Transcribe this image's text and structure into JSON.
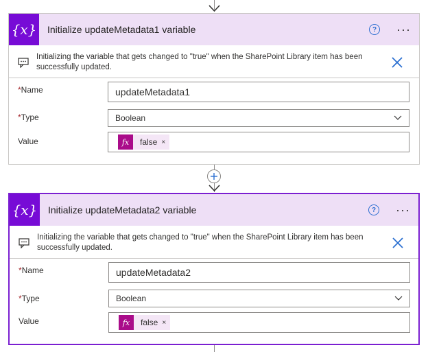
{
  "cards": [
    {
      "title": "Initialize updateMetadata1 variable",
      "icon_text": "{x}",
      "help_label": "?",
      "more_label": "···",
      "info": "Initializing the variable that gets changed to \"true\" when the SharePoint Library item has been successfully updated.",
      "name_label": "Name",
      "name_value": "updateMetadata1",
      "type_label": "Type",
      "type_value": "Boolean",
      "value_label": "Value",
      "token": {
        "fx": "fx",
        "text": "false",
        "remove": "×"
      }
    },
    {
      "title": "Initialize updateMetadata2 variable",
      "icon_text": "{x}",
      "help_label": "?",
      "more_label": "···",
      "info": "Initializing the variable that gets changed to \"true\" when the SharePoint Library item has been successfully updated.",
      "name_label": "Name",
      "name_value": "updateMetadata2",
      "type_label": "Type",
      "type_value": "Boolean",
      "value_label": "Value",
      "token": {
        "fx": "fx",
        "text": "false",
        "remove": "×"
      }
    }
  ],
  "required_mark": "*",
  "colors": {
    "header_bg": "#eedff6",
    "icon_bg": "#770bd6",
    "selected_border": "#7b1fd1",
    "fx_bg": "#aa0c8a",
    "token_bg": "#f4e6f6",
    "required": "#a4262c"
  }
}
